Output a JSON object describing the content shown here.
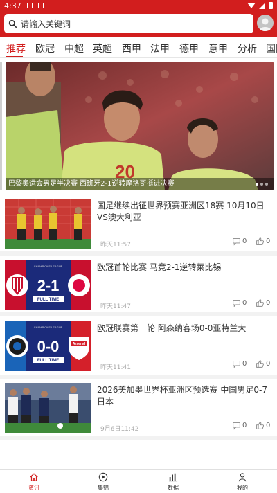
{
  "status_bar": {
    "time": "4:37"
  },
  "search": {
    "placeholder": "请输入关键词"
  },
  "tabs": [
    "推荐",
    "欧冠",
    "中超",
    "英超",
    "西甲",
    "法甲",
    "德甲",
    "意甲",
    "分析",
    "国际"
  ],
  "active_tab": "推荐",
  "banner": {
    "caption": "巴黎奥运会男足半决赛 西班牙2-1逆转摩洛哥挺进决赛",
    "jersey_number": "20"
  },
  "news": [
    {
      "title": "国足继续出征世界预赛亚洲区18赛 10月10日VS澳大利亚",
      "time": "昨天11:57",
      "comments": "0",
      "likes": "0"
    },
    {
      "title": "欧冠首轮比赛 马竞2-1逆转莱比锡",
      "time": "昨天11:47",
      "comments": "0",
      "likes": "0",
      "thumb_score": "2-1",
      "thumb_label": "FULL TIME",
      "thumb_league": "CHAMPIONS LEAGUE"
    },
    {
      "title": "欧冠联赛第一轮 阿森纳客场0-0亚特兰大",
      "time": "昨天11:41",
      "comments": "0",
      "likes": "0",
      "thumb_score": "0-0",
      "thumb_label": "FULL TIME",
      "thumb_league": "CHAMPIONS LEAGUE"
    },
    {
      "title": "2026美加墨世界杯亚洲区预选赛 中国男足0-7日本",
      "time": "9月6日11:42",
      "comments": "0",
      "likes": "0"
    }
  ],
  "bottom_nav": [
    {
      "label": "资讯",
      "icon": "home-icon"
    },
    {
      "label": "集锦",
      "icon": "play-icon"
    },
    {
      "label": "数据",
      "icon": "bar-chart-icon"
    },
    {
      "label": "我的",
      "icon": "user-icon"
    }
  ],
  "colors": {
    "brand": "#d21e1e",
    "background": "#ffffff",
    "separator": "#f2f2f2"
  }
}
